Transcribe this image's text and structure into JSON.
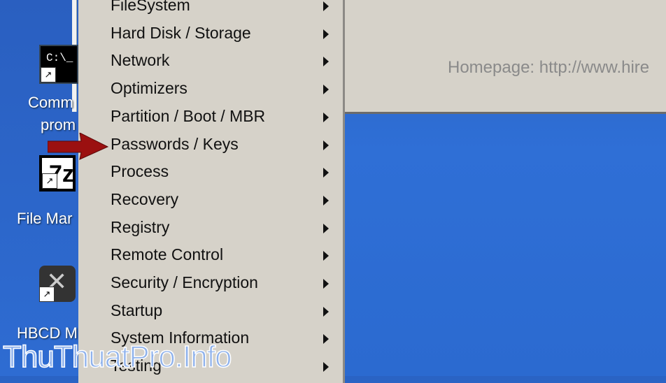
{
  "desktop": {
    "icons": [
      {
        "label": "Comm\nprom",
        "line1": "Comm",
        "line2": "prom",
        "glyph": "C:\\_",
        "icon": "command-prompt-icon"
      },
      {
        "label": "File Mar",
        "glyph": "7z",
        "icon": "file-manager-icon"
      },
      {
        "label": "HBCD M",
        "icon": "wrench-screwdriver-icon"
      }
    ]
  },
  "window": {
    "homepage": "Homepage: http://www.hire"
  },
  "menu": {
    "items": [
      {
        "label": "FileSystem"
      },
      {
        "label": "Hard Disk / Storage"
      },
      {
        "label": "Network"
      },
      {
        "label": "Optimizers"
      },
      {
        "label": "Partition / Boot / MBR"
      },
      {
        "label": "Passwords / Keys"
      },
      {
        "label": "Process"
      },
      {
        "label": "Recovery"
      },
      {
        "label": "Registry"
      },
      {
        "label": "Remote Control"
      },
      {
        "label": "Security / Encryption"
      },
      {
        "label": "Startup"
      },
      {
        "label": "System Information"
      },
      {
        "label": "Testing"
      }
    ],
    "highlighted": "Passwords / Keys"
  },
  "watermark": "ThuThuatPro.Info",
  "colors": {
    "desktop": "#2b6ad0",
    "menu": "#d6d2c9",
    "pointer_arrow": "#9b1010"
  }
}
